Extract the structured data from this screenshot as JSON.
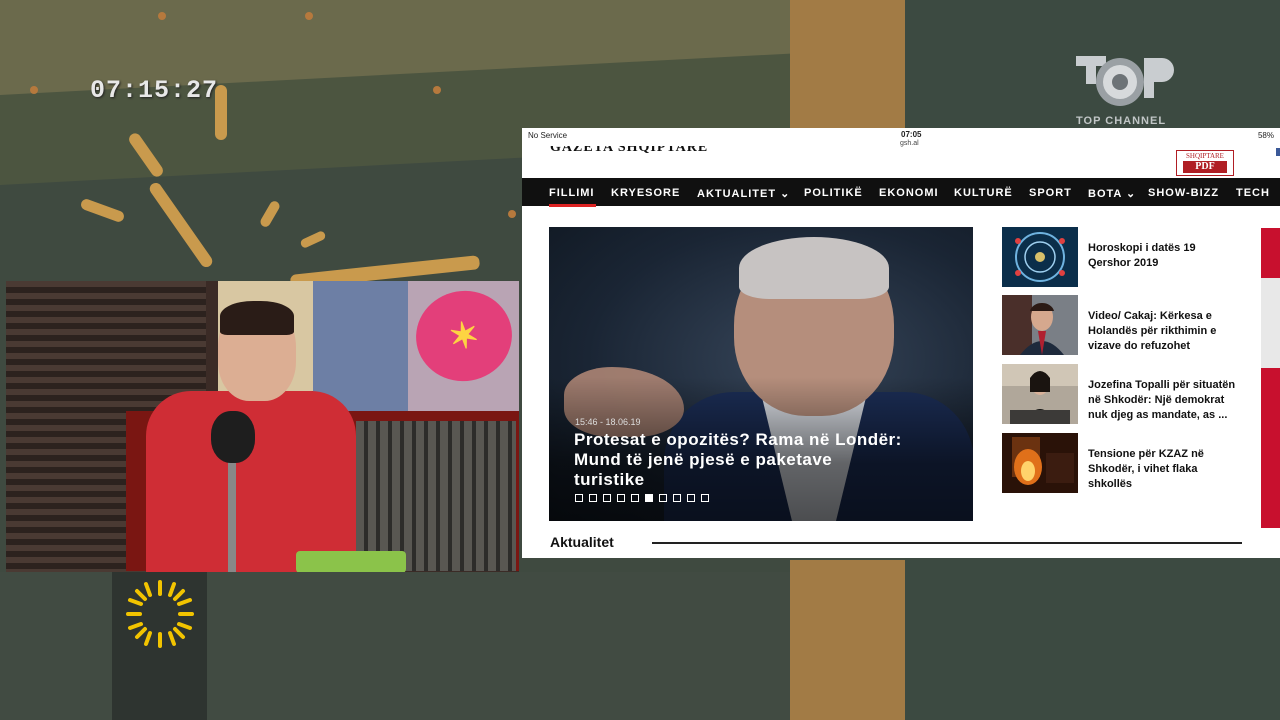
{
  "broadcast": {
    "clock": "07:15:27",
    "channel_name": "TOP CHANNEL"
  },
  "browser": {
    "status_bar": {
      "carrier": "No Service",
      "time": "07:05",
      "url": "gsh.al",
      "battery": "58%"
    },
    "masthead": "GAZETA SHQIPTARE",
    "pdf_badge": {
      "label": "SHQIPTARE",
      "sub": "PDF"
    },
    "nav": {
      "items": [
        "FILLIMI",
        "KRYESORE",
        "AKTUALITET ⌄",
        "POLITIKË",
        "EKONOMI",
        "KULTURË",
        "SPORT",
        "BOTA ⌄",
        "SHOW-BIZZ",
        "TECH"
      ],
      "active_index": 0
    },
    "hero": {
      "timestamp": "15:46 - 18.06.19",
      "headline": "Protesat e opozitës? Rama në Londër: Mund të jenë pjesë e paketave turistike",
      "slide_count": 10,
      "active_slide": 5
    },
    "sidebar": [
      {
        "title": "Horoskopi i datës 19 Qershor 2019",
        "thumb_icon": "zodiac-wheel"
      },
      {
        "title": "Video/ Cakaj: Kërkesa e Holandës për rikthimin e vizave do refuzohet",
        "thumb_icon": "man-portrait"
      },
      {
        "title": "Jozefina Topalli për situatën në Shkodër: Një demokrat nuk djeg as mandate, as ...",
        "thumb_icon": "woman-at-podium"
      },
      {
        "title": "Tensione për KZAZ në Shkodër, i vihet flaka shkollës",
        "thumb_icon": "fire-scene"
      }
    ],
    "section_title": "Aktualitet"
  },
  "colors": {
    "nav_bg": "#101010",
    "accent_red": "#c8102e",
    "studio_orange": "#a27b45"
  }
}
